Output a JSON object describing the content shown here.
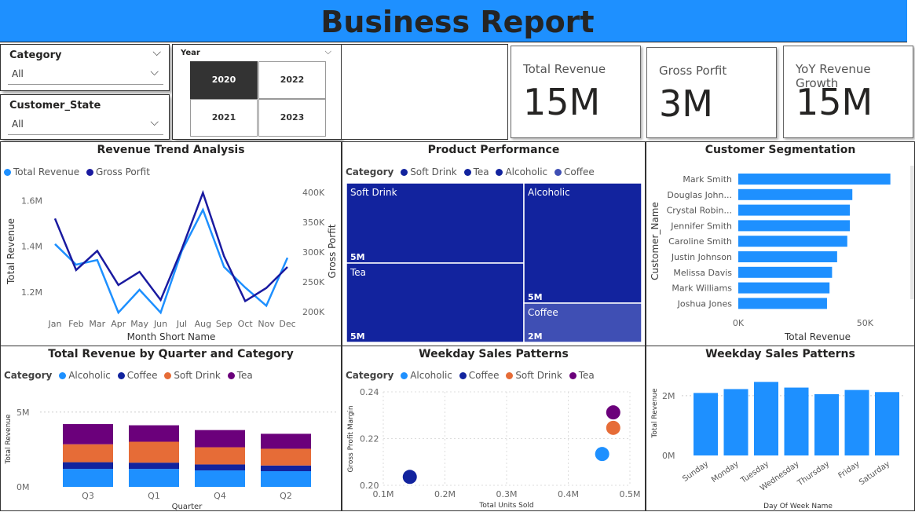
{
  "header": {
    "title": "Business Report"
  },
  "slicers": {
    "category": {
      "label": "Category",
      "value": "All"
    },
    "customer_state": {
      "label": "Customer_State",
      "value": "All"
    },
    "year": {
      "label": "Year",
      "options": [
        "2020",
        "2022",
        "2021",
        "2023"
      ],
      "selected": "2020"
    }
  },
  "kpis": [
    {
      "label": "Total Revenue",
      "value": "15M"
    },
    {
      "label": "Gross Porfit",
      "value": "3M"
    },
    {
      "label": "YoY Revenue Growth",
      "value": "15M"
    }
  ],
  "colors": {
    "light_blue": "#1e90ff",
    "dark_blue": "#1a1aa0",
    "navy": "#12239e",
    "orange": "#e66c37",
    "purple": "#6b007b",
    "coffee_tile": "#3f4fb4"
  },
  "chart_data": [
    {
      "id": "trend",
      "type": "line",
      "title": "Revenue Trend Analysis",
      "xlabel": "Month Short Name",
      "ylabel": "Total Revenue",
      "y2label": "Gross Porfit",
      "categories": [
        "Jan",
        "Feb",
        "Mar",
        "Apr",
        "May",
        "Jun",
        "Jul",
        "Aug",
        "Sep",
        "Oct",
        "Nov",
        "Dec"
      ],
      "y_ticks": [
        "1.6M",
        "1.4M",
        "1.2M"
      ],
      "y2_ticks": [
        "400K",
        "350K",
        "300K",
        "250K",
        "200K"
      ],
      "ylim": [
        1.1,
        1.65
      ],
      "y2lim": [
        195,
        405
      ],
      "series": [
        {
          "name": "Total Revenue",
          "axis": "left",
          "values": [
            1.41,
            1.32,
            1.34,
            1.11,
            1.21,
            1.11,
            1.38,
            1.56,
            1.31,
            1.22,
            1.14,
            1.35
          ]
        },
        {
          "name": "Gross Porfit",
          "axis": "right",
          "values": [
            356,
            270,
            302,
            245,
            267,
            220,
            305,
            399,
            293,
            218,
            240,
            275
          ]
        }
      ]
    },
    {
      "id": "treemap",
      "type": "treemap",
      "title": "Product Performance",
      "legend_title": "Category",
      "legend": [
        "Soft Drink",
        "Tea",
        "Alcoholic",
        "Coffee"
      ],
      "tiles": [
        {
          "name": "Soft Drink",
          "label": "5M"
        },
        {
          "name": "Tea",
          "label": "5M"
        },
        {
          "name": "Alcoholic",
          "label": "5M"
        },
        {
          "name": "Coffee",
          "label": "2M"
        }
      ]
    },
    {
      "id": "segmentation",
      "type": "bar",
      "orientation": "horizontal",
      "title": "Customer Segmentation",
      "xlabel": "Total Revenue",
      "ylabel": "Customer_Name",
      "categories": [
        "Mark Smith",
        "Douglas John...",
        "Crystal Robin...",
        "Jennifer Smith",
        "Caroline Smith",
        "Justin Johnson",
        "Melissa Davis",
        "Mark Williams",
        "Joshua Jones"
      ],
      "values": [
        60000,
        45000,
        44000,
        44000,
        43000,
        39000,
        37000,
        36000,
        35000
      ],
      "x_ticks": [
        "0K",
        "50K"
      ],
      "xlim": [
        0,
        66000
      ]
    },
    {
      "id": "quarter",
      "type": "bar",
      "stacked": true,
      "title": "Total Revenue by Quarter and Category",
      "legend_title": "Category",
      "xlabel": "Quarter",
      "ylabel": "Total Revenue",
      "categories": [
        "Q3",
        "Q1",
        "Q4",
        "Q2"
      ],
      "y_ticks": [
        "5M",
        "0M"
      ],
      "ylim": [
        0,
        5.2
      ],
      "series": [
        {
          "name": "Alcoholic",
          "values": [
            1.2,
            1.2,
            1.1,
            1.05
          ]
        },
        {
          "name": "Coffee",
          "values": [
            0.45,
            0.42,
            0.4,
            0.38
          ]
        },
        {
          "name": "Soft Drink",
          "values": [
            1.2,
            1.4,
            1.15,
            1.12
          ]
        },
        {
          "name": "Tea",
          "values": [
            1.35,
            1.1,
            1.15,
            1.0
          ]
        }
      ]
    },
    {
      "id": "scatter",
      "type": "scatter",
      "title": "Weekday Sales Patterns",
      "legend_title": "Category",
      "xlabel": "Total Units Sold",
      "ylabel": "Gross Profit Margin",
      "x_ticks": [
        "0.1M",
        "0.2M",
        "0.3M",
        "0.4M",
        "0.5M"
      ],
      "y_ticks": [
        "0.24",
        "0.22",
        "0.20"
      ],
      "xlim": [
        0.1,
        0.5
      ],
      "ylim": [
        0.2,
        0.24
      ],
      "series": [
        {
          "name": "Alcoholic",
          "x": 0.455,
          "y": 0.2134
        },
        {
          "name": "Coffee",
          "x": 0.143,
          "y": 0.2036
        },
        {
          "name": "Soft Drink",
          "x": 0.473,
          "y": 0.2246
        },
        {
          "name": "Tea",
          "x": 0.473,
          "y": 0.2312
        }
      ]
    },
    {
      "id": "weekday",
      "type": "bar",
      "title": "Weekday Sales Patterns",
      "xlabel": "Day Of Week Name",
      "ylabel": "Total Revenue",
      "categories": [
        "Sunday",
        "Monday",
        "Tuesday",
        "Wednesday",
        "Thursday",
        "Friday",
        "Saturday"
      ],
      "values": [
        2.09,
        2.22,
        2.46,
        2.27,
        2.05,
        2.19,
        2.12
      ],
      "y_ticks": [
        "2M",
        "0M"
      ],
      "ylim": [
        0,
        2.6
      ]
    }
  ]
}
